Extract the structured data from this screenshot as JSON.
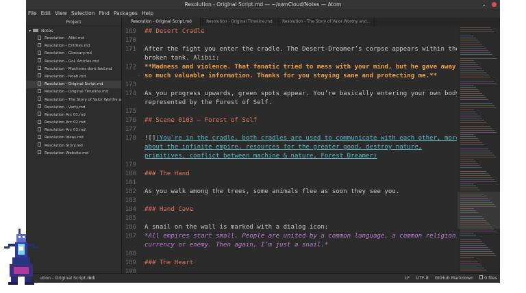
{
  "window": {
    "title": "Resolution - Original Script.md — ~/ownCloud/Notes — Atom",
    "minimize_glyph": "⌄"
  },
  "menu": [
    "File",
    "Edit",
    "View",
    "Selection",
    "Find",
    "Packages",
    "Help"
  ],
  "sidebar": {
    "header": "Project",
    "folder": "Notes",
    "files": [
      "Resolution - Alibi.md",
      "Resolution - Entities.md",
      "Resolution - Glossary.md",
      "Resolution - GoL Articles.md",
      "Resolution - Machines dont feel.md",
      "Resolution - Noah.md",
      "Resolution - Original Script.md",
      "Resolution - Original Timeline.md",
      "Resolution - The Story of Valor Worthy and f",
      "Resolution - Varty.md",
      "Resolution Arc 01.md",
      "Resolution Arc 02.md",
      "Resolution Arc 03.md",
      "Resolution Ideas.md",
      "Resolution Story.md",
      "Resolution Website.md"
    ],
    "selected_index": 6
  },
  "tabs": [
    {
      "label": "Resolution - Original Script.md",
      "active": true
    },
    {
      "label": "Resolution - Original Timeline.md",
      "active": false
    },
    {
      "label": "Resolution - The Story of Valor Worthy and...",
      "active": false
    }
  ],
  "editor": {
    "lines": [
      {
        "n": "169",
        "parts": [
          {
            "t": "## Desert Cradle",
            "c": "c-head"
          }
        ]
      },
      {
        "n": "170",
        "parts": []
      },
      {
        "n": "171",
        "parts": [
          {
            "t": "After the fight you enter the cradle. The Desert-Dreamer’s corpse appears within the",
            "c": "c-plain"
          }
        ]
      },
      {
        "n": "",
        "parts": [
          {
            "t": "broken tank. Alibii:",
            "c": "c-plain"
          }
        ]
      },
      {
        "n": "172",
        "parts": [
          {
            "t": "**Madness and violence. That fanatic tried to mess with your mind, but he gave away",
            "c": "c-bold"
          }
        ]
      },
      {
        "n": "",
        "fold": "·",
        "parts": [
          {
            "t": "so much valuable information. Thanks for you staying sane and protecting me.**",
            "c": "c-bold"
          }
        ]
      },
      {
        "n": "173",
        "parts": []
      },
      {
        "n": "174",
        "parts": [
          {
            "t": "As you progress upwards, green spots appear. You’re basically entering your own body,",
            "c": "c-plain"
          }
        ]
      },
      {
        "n": "",
        "parts": [
          {
            "t": "represented by the Forest of Self.",
            "c": "c-plain"
          }
        ]
      },
      {
        "n": "175",
        "parts": []
      },
      {
        "n": "176",
        "parts": [
          {
            "t": "## Scene 0103 – Forest of Self",
            "c": "c-head"
          }
        ]
      },
      {
        "n": "177",
        "parts": []
      },
      {
        "n": "178",
        "parts": [
          {
            "t": "![]",
            "c": "c-plain"
          },
          {
            "t": "(You’re in the cradle, both cradles are used to communicate with each other, more",
            "c": "c-link"
          }
        ]
      },
      {
        "n": "",
        "parts": [
          {
            "t": "about the infinite empire, resources for the greater good, destroy nature,",
            "c": "c-link"
          }
        ]
      },
      {
        "n": "",
        "parts": [
          {
            "t": "primitives, conflict between machine & nature, Forest Dreamer)",
            "c": "c-link"
          }
        ]
      },
      {
        "n": "179",
        "parts": []
      },
      {
        "n": "180",
        "parts": [
          {
            "t": "### The Hand",
            "c": "c-head"
          }
        ]
      },
      {
        "n": "181",
        "parts": []
      },
      {
        "n": "182",
        "parts": [
          {
            "t": "As you walk among the trees, some animals flee as soon they see you.",
            "c": "c-plain"
          }
        ]
      },
      {
        "n": "183",
        "parts": []
      },
      {
        "n": "184",
        "parts": [
          {
            "t": "### Hand Cave",
            "c": "c-head"
          }
        ]
      },
      {
        "n": "185",
        "parts": []
      },
      {
        "n": "186",
        "parts": [
          {
            "t": "A snail on the wall is marked with a dialog icon:",
            "c": "c-plain"
          }
        ]
      },
      {
        "n": "187",
        "parts": [
          {
            "t": "*All empires start small. People are united by a common language, a common religion,",
            "c": "c-ital"
          }
        ]
      },
      {
        "n": "",
        "parts": [
          {
            "t": "currency or enemy. Then again, I’m just a snail.*",
            "c": "c-ital"
          }
        ]
      },
      {
        "n": "188",
        "parts": []
      },
      {
        "n": "189",
        "parts": [
          {
            "t": "### The Heart",
            "c": "c-head"
          }
        ]
      },
      {
        "n": "190",
        "parts": []
      }
    ]
  },
  "status": {
    "file": "ution - Original Script.md",
    "position": "1:1",
    "line_ending": "LF",
    "encoding": "UTF-8",
    "grammar": "GitHub Markdown",
    "files": "0 files"
  },
  "colors": {
    "heading": "#e5735f",
    "bold": "#f0a24a",
    "link": "#5bb8c7",
    "italic": "#c07ad6",
    "text": "#c9c9c9",
    "close_button": "#e0514b"
  }
}
